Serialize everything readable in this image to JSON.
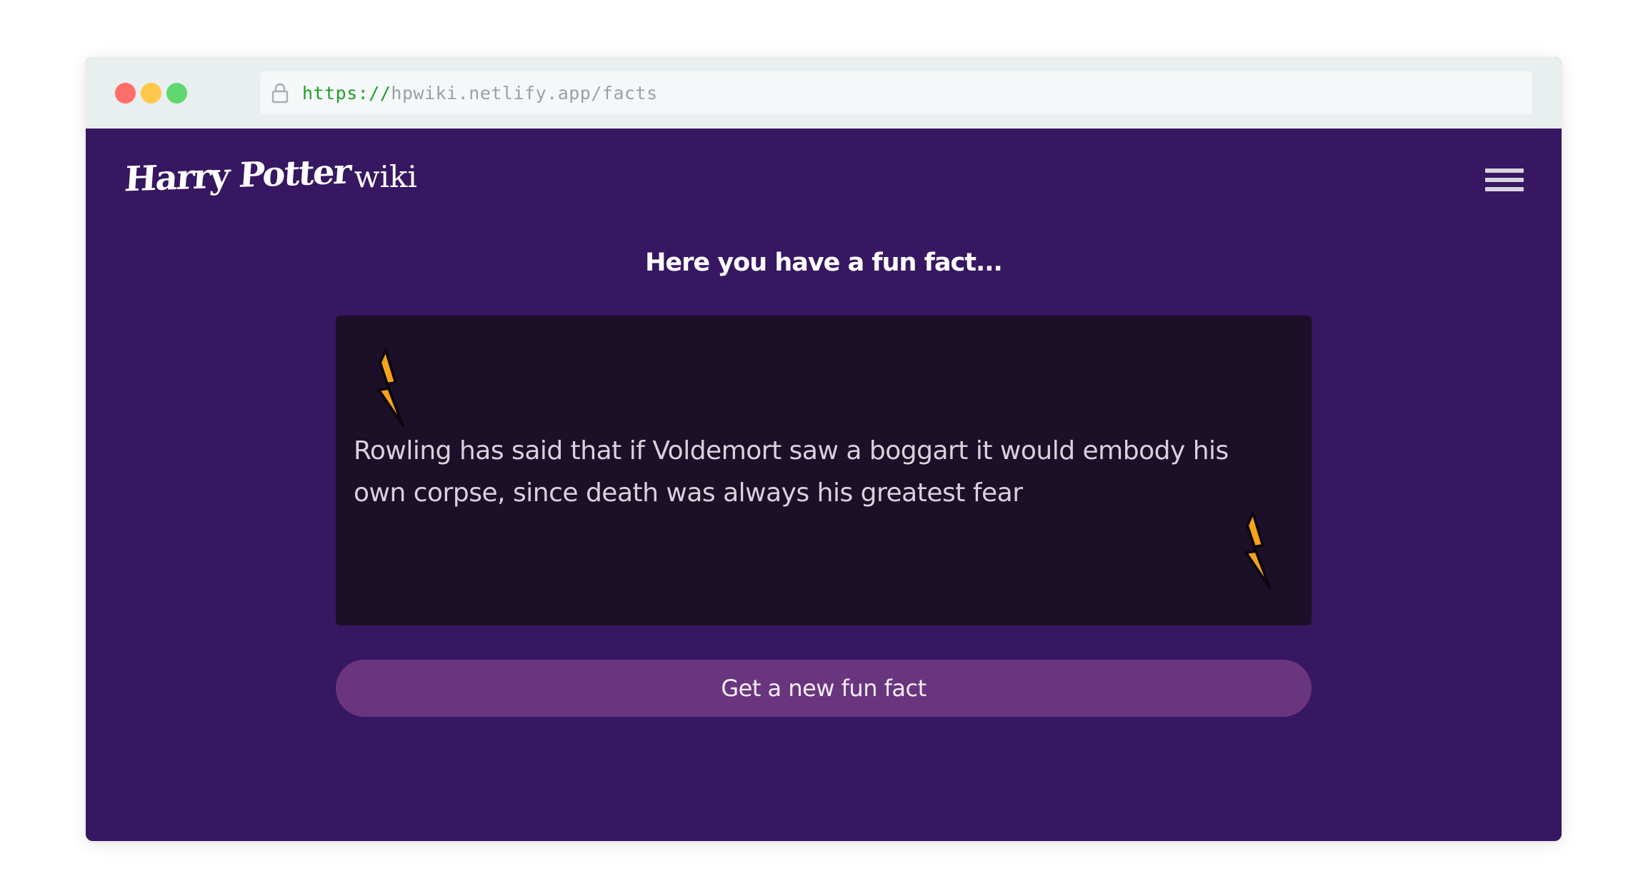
{
  "browser": {
    "url_scheme": "https://",
    "url_rest": "hpwiki.netlify.app/facts"
  },
  "header": {
    "logo_main": "Harry Potter",
    "logo_sub": "wiki",
    "menu_icon": "hamburger-menu-icon"
  },
  "main": {
    "heading": "Here you have a fun fact...",
    "fact_text": "Rowling has said that if Voldemort saw a boggart it would embody his own corpse, since death was always his greatest fear",
    "bolt_icon": "lightning-bolt-icon",
    "button_label": "Get a new fun fact"
  },
  "colors": {
    "page_background": "#371761",
    "card_background": "#1c1029",
    "button_background": "#6a357f",
    "bolt_fill": "#f5a31a"
  }
}
